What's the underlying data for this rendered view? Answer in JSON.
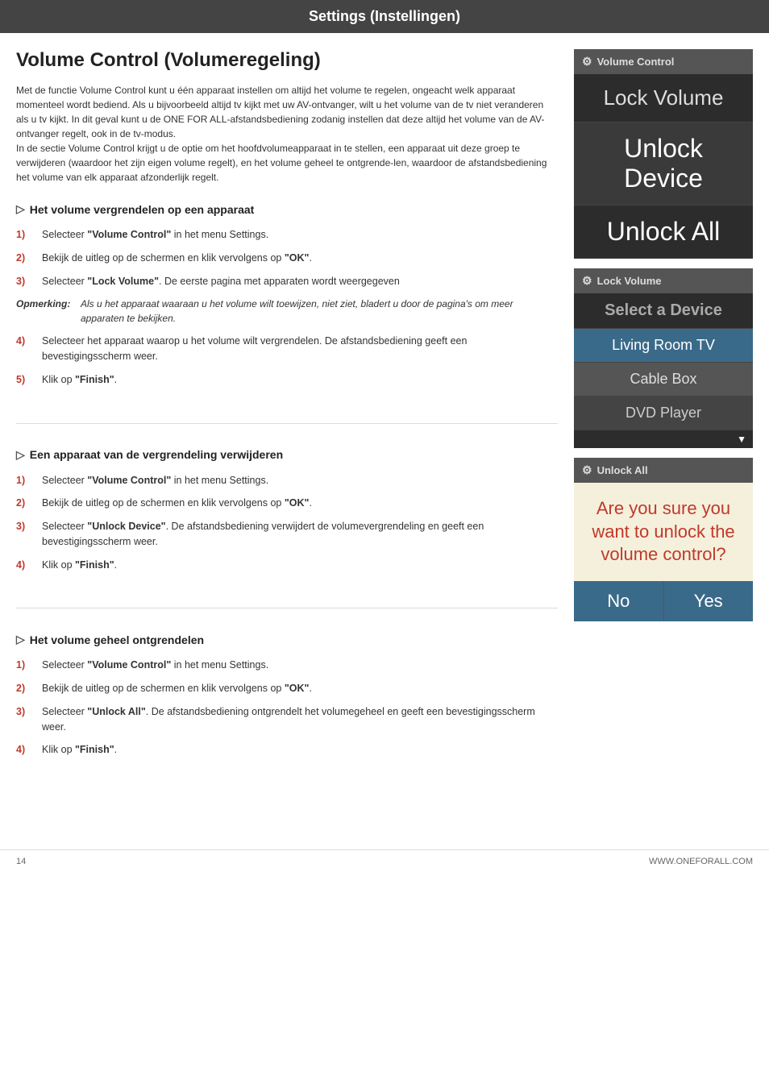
{
  "header": {
    "title": "Settings (Instellingen)"
  },
  "left": {
    "section_title": "Volume Control (Volumeregeling)",
    "intro": "Met de functie Volume Control kunt u één apparaat instellen om altijd het volume te regelen, ongeacht welk apparaat momenteel wordt bediend.  Als u bijvoorbeeld altijd tv kijkt met uw AV-ontvanger, wilt u het volume van de tv niet veranderen als u tv kijkt. In dit geval kunt u de ONE FOR ALL-afstandsbediening zodanig instellen dat deze altijd het volume van de AV-ontvanger regelt, ook in de tv-modus.\nIn de sectie Volume Control krijgt u de optie om het hoofdvolumeapparaat in te stellen, een apparaat uit deze groep te verwijderen (waardoor het zijn eigen volume regelt), en het volume geheel te ontgrende-len, waardoor de afstandsbediening het volume van elk apparaat afzonderlijk regelt.",
    "subsections": [
      {
        "id": "lock",
        "title": "Het volume vergrendelen op een apparaat",
        "steps": [
          {
            "num": "1)",
            "text": "Selecteer <b>\"Volume Control\"</b> in het menu Settings."
          },
          {
            "num": "2)",
            "text": "Bekijk de uitleg op de schermen en klik vervolgens op <b>\"OK\"</b>."
          },
          {
            "num": "3)",
            "text": "Selecteer <b>\"Lock Volume\"</b>. De eerste pagina met apparaten wordt weergegeven"
          }
        ],
        "note": {
          "label": "Opmerking:",
          "text": "Als u het apparaat waaraan u het volume wilt toewijzen, niet ziet, bladert u door de pagina's om meer apparaten te bekijken."
        },
        "steps_continued": [
          {
            "num": "4)",
            "text": "Selecteer het apparaat waarop u het volume wilt vergrendelen. De afstandsbediening geeft een bevestigingsscherm weer."
          },
          {
            "num": "5)",
            "text": "Klik op <b>\"Finish\"</b>."
          }
        ]
      },
      {
        "id": "unlock-device",
        "title": "Een apparaat van de vergrendeling verwijderen",
        "steps": [
          {
            "num": "1)",
            "text": "Selecteer <b>\"Volume Control\"</b> in het menu Settings."
          },
          {
            "num": "2)",
            "text": "Bekijk de uitleg op de schermen en klik vervolgens op <b>\"OK\"</b>."
          },
          {
            "num": "3)",
            "text": "Selecteer <b>\"Unlock Device\"</b>. De afstandsbediening verwijdert de volumevergrendeling en geeft een bevestigingsscherm weer."
          },
          {
            "num": "4)",
            "text": "Klik op <b>\"Finish\"</b>."
          }
        ]
      },
      {
        "id": "unlock-all",
        "title": "Het volume geheel ontgrendelen",
        "steps": [
          {
            "num": "1)",
            "text": "Selecteer <b>\"Volume Control\"</b> in het menu Settings."
          },
          {
            "num": "2)",
            "text": "Bekijk de uitleg op de schermen en klik vervolgens op <b>\"OK\"</b>."
          },
          {
            "num": "3)",
            "text": "Selecteer <b>\"Unlock All\"</b>. De afstandsbediening ontgrendelt het volumegeheel en geeft een bevestigingsscherm weer."
          },
          {
            "num": "4)",
            "text": "Klik op <b>\"Finish\"</b>."
          }
        ]
      }
    ]
  },
  "sidebar": {
    "panel1": {
      "header": "Volume Control",
      "items": [
        {
          "label": "Lock Volume",
          "type": "lock-volume"
        },
        {
          "label": "Unlock Device",
          "type": "unlock-device"
        },
        {
          "label": "Unlock All",
          "type": "unlock-all"
        }
      ]
    },
    "panel2": {
      "header": "Lock Volume",
      "select_title": "Select a Device",
      "devices": [
        {
          "label": "Living Room TV",
          "type": "living-room"
        },
        {
          "label": "Cable Box",
          "type": "cable-box"
        },
        {
          "label": "DVD Player",
          "type": "dvd-player"
        }
      ]
    },
    "panel3": {
      "header": "Unlock All",
      "confirm_text": "Are you sure you want to unlock the volume control?",
      "btn_no": "No",
      "btn_yes": "Yes"
    }
  },
  "footer": {
    "page_number": "14",
    "website": "WWW.ONEFORALL.COM"
  }
}
